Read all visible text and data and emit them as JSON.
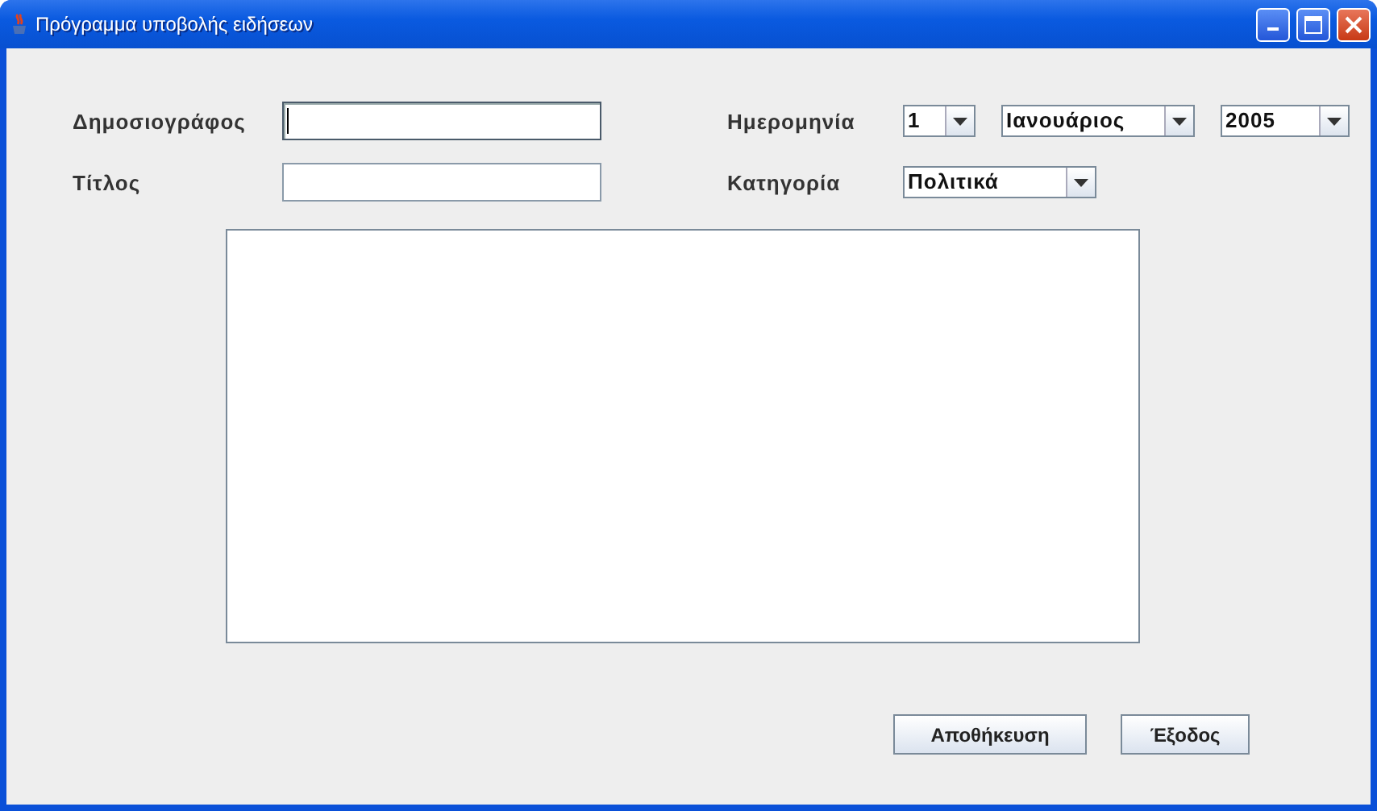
{
  "window": {
    "title": "Πρόγραμμα υποβολής ειδήσεων"
  },
  "fields": [
    {
      "label": "Δημοσιογράφος",
      "focused": true
    },
    {
      "label": "Τίτλος",
      "focused": false
    }
  ],
  "date": {
    "label": "Ημερομηνία",
    "day": "1",
    "month": "Ιανουάριος",
    "year": "2005"
  },
  "category": {
    "label": "Κατηγορία",
    "value": "Πολιτικά"
  },
  "buttons": [
    "Αποθήκευση",
    "Έξοδος"
  ]
}
